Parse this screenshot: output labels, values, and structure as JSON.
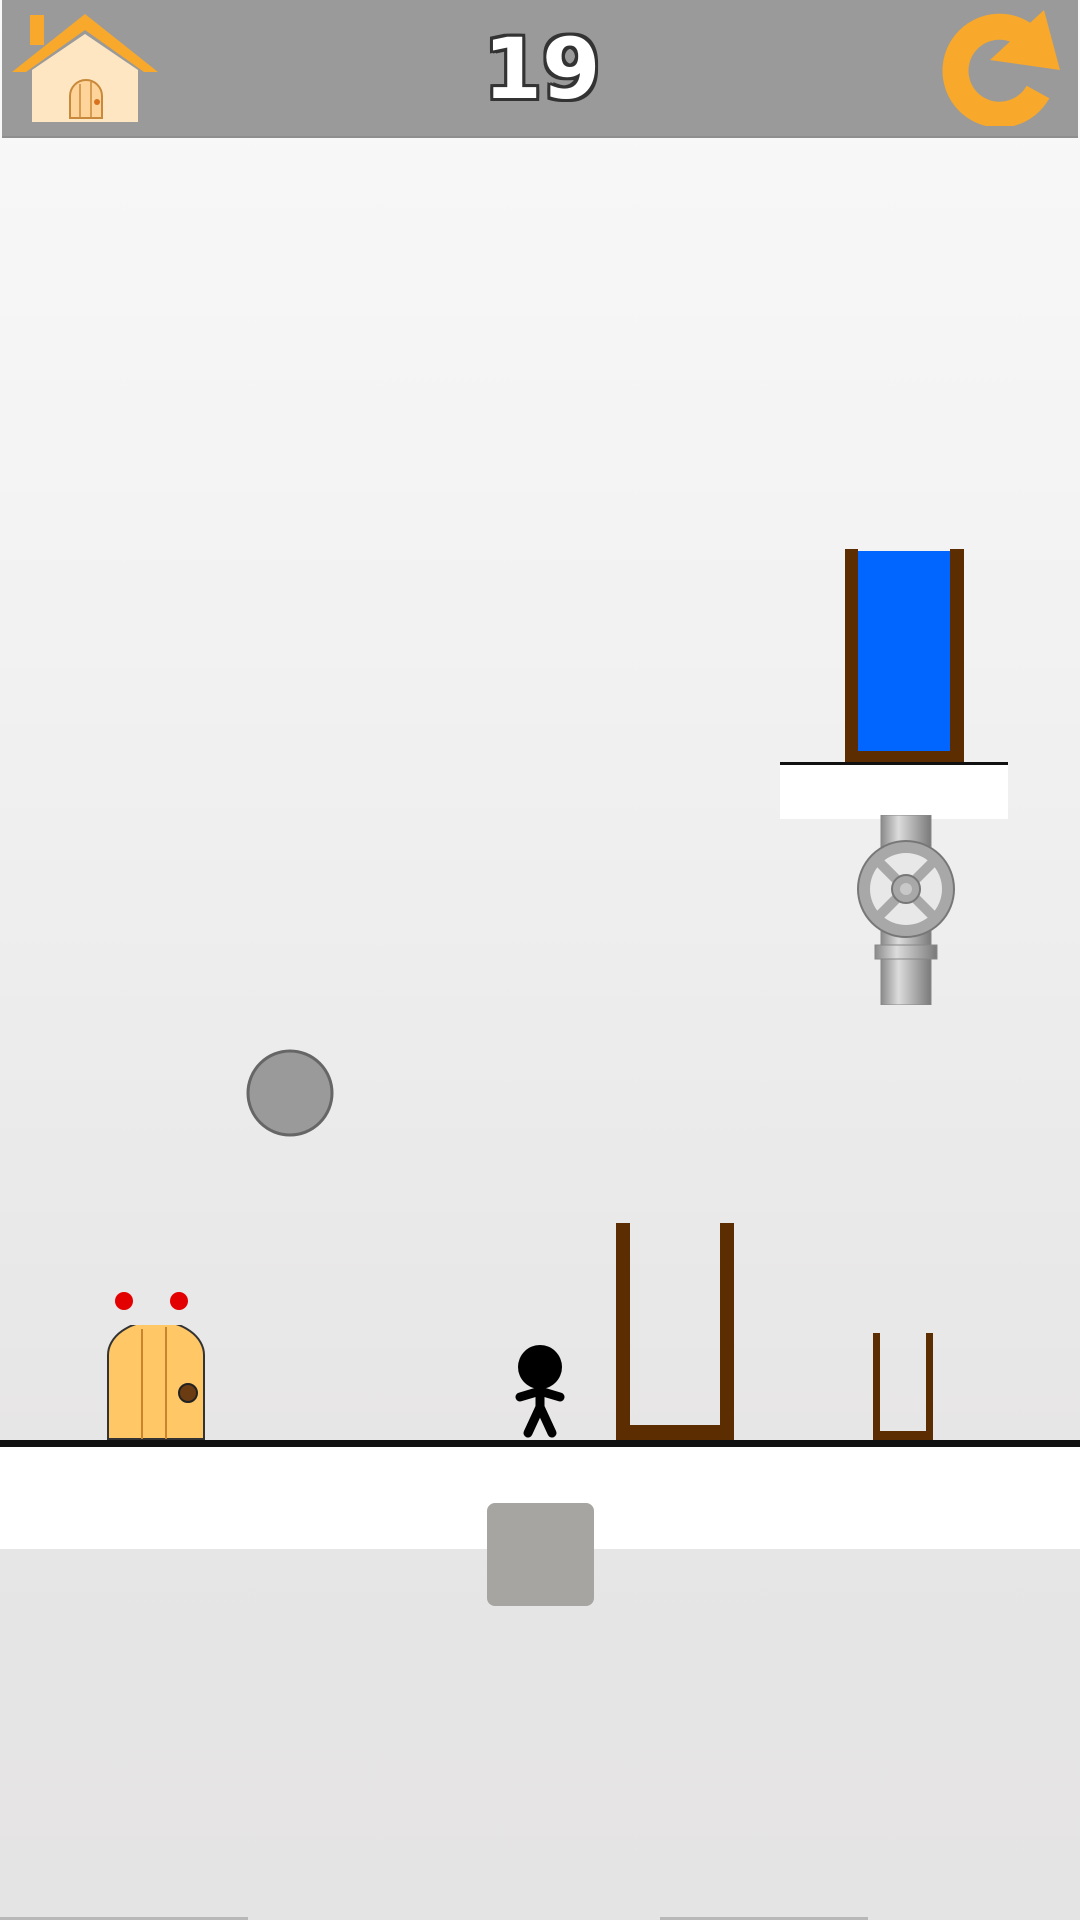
{
  "header": {
    "level_number": "19",
    "home_icon": "house-icon",
    "restart_icon": "restart-arrow-icon"
  },
  "scene": {
    "water_color": "#0066ff",
    "container_color": "#5c2d00",
    "door_color": "#ffc766",
    "lights_color": "#e30000",
    "ball_color": "#9a9a9a",
    "character_color": "#000000",
    "action_button_color": "#a6a5a1",
    "header_accent": "#f8a82a"
  }
}
